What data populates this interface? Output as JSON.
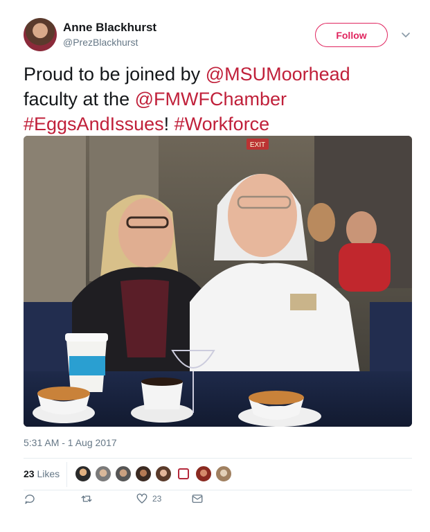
{
  "author": {
    "name": "Anne Blackhurst",
    "handle": "@PrezBlackhurst"
  },
  "follow_label": "Follow",
  "tweet": {
    "text_1": "Proud to be joined by ",
    "mention_1": "@MSUMoorhead",
    "text_2": "faculty at the ",
    "mention_2": "@FMWFChamber",
    "hashtag_1": "#EggsAndIssues",
    "text_3": "! ",
    "hashtag_2": "#Workforce"
  },
  "photo": {
    "exit_sign": "EXIT"
  },
  "timestamp": "5:31 AM - 1 Aug 2017",
  "likes": {
    "count": "23",
    "label": "Likes"
  },
  "actions": {
    "like_count": "23"
  },
  "colors": {
    "accent": "#c0203a",
    "follow": "#e0245e",
    "muted": "#657786"
  },
  "icons": [
    "reply-icon",
    "retweet-icon",
    "heart-icon",
    "message-icon",
    "chevron-down-icon"
  ]
}
